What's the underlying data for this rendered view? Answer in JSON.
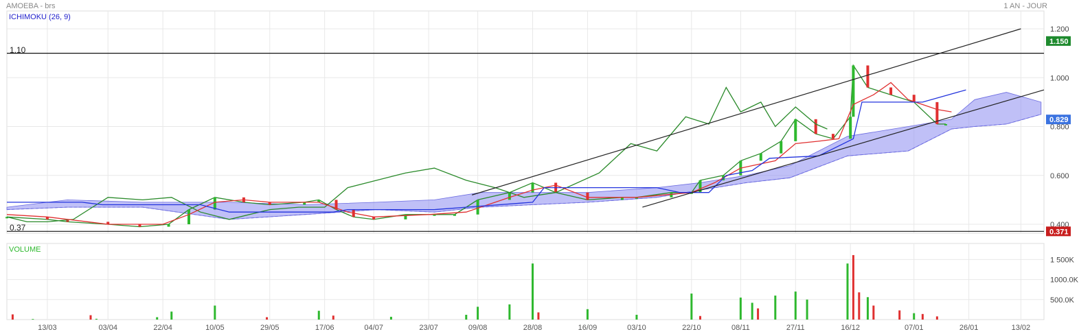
{
  "header": {
    "left": "AMOEBA - brs",
    "right": "1 AN - JOUR"
  },
  "price_panel": {
    "indicator_label": "ICHIMOKU (26, 9)",
    "hline_labels": [
      "1.10",
      "0.37"
    ],
    "y_ticks": [
      "1.200",
      "1.000",
      "0.800",
      "0.600",
      "0.400"
    ],
    "badges": [
      {
        "text": "1.150",
        "color": "#1e8a2e",
        "value": 1.15
      },
      {
        "text": "0.829",
        "color": "#3b73e0",
        "value": 0.829
      },
      {
        "text": "0.371",
        "color": "#c81e1e",
        "value": 0.371
      }
    ]
  },
  "volume_panel": {
    "label": "VOLUME",
    "y_ticks": [
      "1 500K",
      "1000.0K",
      "500.0K"
    ]
  },
  "x_ticks": [
    "13/03",
    "03/04",
    "22/04",
    "10/05",
    "29/05",
    "17/06",
    "04/07",
    "23/07",
    "09/08",
    "28/08",
    "16/09",
    "03/10",
    "22/10",
    "08/11",
    "27/11",
    "16/12",
    "07/01",
    "26/01",
    "13/02"
  ],
  "chart_data": [
    {
      "type": "line",
      "title": "AMOEBA - brs",
      "subtitle": "1 AN - JOUR",
      "indicator": "ICHIMOKU (26, 9)",
      "x_range": [
        "2023-02-27",
        "2024-02-21"
      ],
      "ylim": [
        0.37,
        1.22
      ],
      "horizontal_lines": [
        1.1,
        0.371
      ],
      "trendlines": [
        {
          "from": [
            "2023-08-07",
            0.52
          ],
          "to": [
            "2024-02-13",
            1.2
          ]
        },
        {
          "from": [
            "2023-10-05",
            0.47
          ],
          "to": [
            "2024-02-21",
            0.95
          ]
        }
      ],
      "series": [
        {
          "name": "price",
          "color": "#2a8a2a",
          "points": [
            [
              "2023-02-27",
              0.43
            ],
            [
              "2023-03-13",
              0.42
            ],
            [
              "2023-03-20",
              0.41
            ],
            [
              "2023-04-03",
              0.4
            ],
            [
              "2023-04-14",
              0.39
            ],
            [
              "2023-04-24",
              0.4
            ],
            [
              "2023-05-01",
              0.46
            ],
            [
              "2023-05-10",
              0.51
            ],
            [
              "2023-05-20",
              0.49
            ],
            [
              "2023-05-29",
              0.48
            ],
            [
              "2023-06-10",
              0.49
            ],
            [
              "2023-06-15",
              0.5
            ],
            [
              "2023-06-21",
              0.46
            ],
            [
              "2023-06-27",
              0.43
            ],
            [
              "2023-07-04",
              0.42
            ],
            [
              "2023-07-15",
              0.44
            ],
            [
              "2023-07-25",
              0.44
            ],
            [
              "2023-08-01",
              0.44
            ],
            [
              "2023-08-09",
              0.5
            ],
            [
              "2023-08-20",
              0.53
            ],
            [
              "2023-08-28",
              0.57
            ],
            [
              "2023-09-05",
              0.53
            ],
            [
              "2023-09-16",
              0.5
            ],
            [
              "2023-09-28",
              0.51
            ],
            [
              "2023-10-03",
              0.51
            ],
            [
              "2023-10-15",
              0.53
            ],
            [
              "2023-10-22",
              0.53
            ],
            [
              "2023-10-25",
              0.58
            ],
            [
              "2023-11-02",
              0.6
            ],
            [
              "2023-11-08",
              0.66
            ],
            [
              "2023-11-15",
              0.69
            ],
            [
              "2023-11-22",
              0.74
            ],
            [
              "2023-11-27",
              0.83
            ],
            [
              "2023-12-04",
              0.77
            ],
            [
              "2023-12-10",
              0.75
            ],
            [
              "2023-12-16",
              0.84
            ],
            [
              "2023-12-17",
              1.05
            ],
            [
              "2023-12-22",
              0.96
            ],
            [
              "2023-12-30",
              0.93
            ],
            [
              "2024-01-07",
              0.9
            ],
            [
              "2024-01-15",
              0.81
            ],
            [
              "2024-01-18",
              0.81
            ]
          ]
        },
        {
          "name": "lagging",
          "color": "#2a8a2a",
          "points": [
            [
              "2023-02-27",
              0.43
            ],
            [
              "2023-03-06",
              0.41
            ],
            [
              "2023-03-13",
              0.41
            ],
            [
              "2023-03-22",
              0.42
            ],
            [
              "2023-04-03",
              0.51
            ],
            [
              "2023-04-15",
              0.5
            ],
            [
              "2023-04-25",
              0.51
            ],
            [
              "2023-05-05",
              0.45
            ],
            [
              "2023-05-15",
              0.42
            ],
            [
              "2023-05-29",
              0.46
            ],
            [
              "2023-06-08",
              0.47
            ],
            [
              "2023-06-17",
              0.47
            ],
            [
              "2023-06-25",
              0.55
            ],
            [
              "2023-07-05",
              0.58
            ],
            [
              "2023-07-15",
              0.61
            ],
            [
              "2023-07-25",
              0.63
            ],
            [
              "2023-08-05",
              0.58
            ],
            [
              "2023-08-15",
              0.55
            ],
            [
              "2023-08-25",
              0.51
            ],
            [
              "2023-09-05",
              0.53
            ],
            [
              "2023-09-20",
              0.61
            ],
            [
              "2023-10-01",
              0.73
            ],
            [
              "2023-10-10",
              0.7
            ],
            [
              "2023-10-20",
              0.84
            ],
            [
              "2023-10-28",
              0.81
            ],
            [
              "2023-11-03",
              0.96
            ],
            [
              "2023-11-08",
              0.86
            ],
            [
              "2023-11-15",
              0.9
            ],
            [
              "2023-11-20",
              0.8
            ],
            [
              "2023-11-27",
              0.88
            ],
            [
              "2023-12-04",
              0.81
            ],
            [
              "2023-12-08",
              0.79
            ]
          ]
        },
        {
          "name": "tenkan",
          "color": "#e03030",
          "points": [
            [
              "2023-02-27",
              0.44
            ],
            [
              "2023-03-13",
              0.43
            ],
            [
              "2023-04-03",
              0.4
            ],
            [
              "2023-04-22",
              0.4
            ],
            [
              "2023-05-01",
              0.44
            ],
            [
              "2023-05-10",
              0.49
            ],
            [
              "2023-05-20",
              0.5
            ],
            [
              "2023-05-29",
              0.49
            ],
            [
              "2023-06-15",
              0.49
            ],
            [
              "2023-06-25",
              0.45
            ],
            [
              "2023-07-04",
              0.43
            ],
            [
              "2023-07-23",
              0.44
            ],
            [
              "2023-08-05",
              0.45
            ],
            [
              "2023-08-20",
              0.51
            ],
            [
              "2023-08-28",
              0.54
            ],
            [
              "2023-09-05",
              0.56
            ],
            [
              "2023-09-16",
              0.51
            ],
            [
              "2023-10-03",
              0.51
            ],
            [
              "2023-10-22",
              0.53
            ],
            [
              "2023-10-30",
              0.57
            ],
            [
              "2023-11-08",
              0.63
            ],
            [
              "2023-11-20",
              0.66
            ],
            [
              "2023-11-27",
              0.73
            ],
            [
              "2023-12-05",
              0.74
            ],
            [
              "2023-12-12",
              0.75
            ],
            [
              "2023-12-17",
              0.89
            ],
            [
              "2023-12-24",
              0.93
            ],
            [
              "2023-12-30",
              0.98
            ],
            [
              "2024-01-05",
              0.91
            ],
            [
              "2024-01-15",
              0.87
            ],
            [
              "2024-01-20",
              0.86
            ]
          ]
        },
        {
          "name": "kijun",
          "color": "#2233dd",
          "points": [
            [
              "2023-02-27",
              0.49
            ],
            [
              "2023-03-25",
              0.49
            ],
            [
              "2023-04-01",
              0.48
            ],
            [
              "2023-05-05",
              0.48
            ],
            [
              "2023-05-15",
              0.45
            ],
            [
              "2023-06-20",
              0.45
            ],
            [
              "2023-06-25",
              0.46
            ],
            [
              "2023-07-25",
              0.46
            ],
            [
              "2023-08-05",
              0.47
            ],
            [
              "2023-08-28",
              0.49
            ],
            [
              "2023-09-01",
              0.55
            ],
            [
              "2023-10-10",
              0.55
            ],
            [
              "2023-10-18",
              0.53
            ],
            [
              "2023-10-28",
              0.53
            ],
            [
              "2023-11-03",
              0.6
            ],
            [
              "2023-11-12",
              0.62
            ],
            [
              "2023-11-18",
              0.67
            ],
            [
              "2023-12-05",
              0.68
            ],
            [
              "2023-12-17",
              0.75
            ],
            [
              "2023-12-20",
              0.9
            ],
            [
              "2024-01-10",
              0.9
            ],
            [
              "2024-01-25",
              0.95
            ]
          ]
        }
      ],
      "cloud": {
        "color": "#8c8cf0",
        "points": [
          [
            "2023-02-27",
            0.47,
            0.46
          ],
          [
            "2023-03-20",
            0.5,
            0.47
          ],
          [
            "2023-04-15",
            0.49,
            0.47
          ],
          [
            "2023-05-15",
            0.49,
            0.42
          ],
          [
            "2023-06-10",
            0.48,
            0.44
          ],
          [
            "2023-07-05",
            0.49,
            0.46
          ],
          [
            "2023-07-25",
            0.5,
            0.45
          ],
          [
            "2023-08-10",
            0.53,
            0.47
          ],
          [
            "2023-08-28",
            0.53,
            0.48
          ],
          [
            "2023-09-16",
            0.53,
            0.49
          ],
          [
            "2023-10-10",
            0.55,
            0.51
          ],
          [
            "2023-10-25",
            0.57,
            0.54
          ],
          [
            "2023-11-10",
            0.6,
            0.57
          ],
          [
            "2023-11-25",
            0.64,
            0.59
          ],
          [
            "2023-12-15",
            0.76,
            0.68
          ],
          [
            "2024-01-05",
            0.8,
            0.7
          ],
          [
            "2024-01-20",
            0.83,
            0.79
          ],
          [
            "2024-01-28",
            0.91,
            0.8
          ],
          [
            "2024-02-08",
            0.94,
            0.81
          ],
          [
            "2024-02-20",
            0.9,
            0.85
          ]
        ]
      }
    },
    {
      "type": "bar",
      "title": "VOLUME",
      "ylim": [
        0,
        1900000
      ],
      "series": [
        {
          "name": "up",
          "color": "#2eb82e",
          "values": [
            [
              "2023-03-08",
              15000
            ],
            [
              "2023-03-30",
              20000
            ],
            [
              "2023-04-20",
              60000
            ],
            [
              "2023-04-25",
              200000
            ],
            [
              "2023-05-10",
              350000
            ],
            [
              "2023-06-15",
              220000
            ],
            [
              "2023-07-10",
              70000
            ],
            [
              "2023-08-05",
              120000
            ],
            [
              "2023-08-09",
              320000
            ],
            [
              "2023-08-20",
              380000
            ],
            [
              "2023-08-28",
              1400000
            ],
            [
              "2023-09-16",
              260000
            ],
            [
              "2023-10-03",
              120000
            ],
            [
              "2023-10-22",
              650000
            ],
            [
              "2023-11-08",
              550000
            ],
            [
              "2023-11-12",
              420000
            ],
            [
              "2023-11-20",
              600000
            ],
            [
              "2023-11-27",
              700000
            ],
            [
              "2023-12-01",
              500000
            ],
            [
              "2023-12-15",
              1400000
            ],
            [
              "2023-12-22",
              560000
            ],
            [
              "2024-01-07",
              160000
            ]
          ]
        },
        {
          "name": "down",
          "color": "#e03030",
          "values": [
            [
              "2023-03-01",
              130000
            ],
            [
              "2023-03-28",
              110000
            ],
            [
              "2023-05-28",
              60000
            ],
            [
              "2023-06-20",
              100000
            ],
            [
              "2023-08-30",
              180000
            ],
            [
              "2023-10-25",
              90000
            ],
            [
              "2023-11-14",
              280000
            ],
            [
              "2023-12-17",
              1610000
            ],
            [
              "2023-12-19",
              680000
            ],
            [
              "2023-12-24",
              350000
            ],
            [
              "2024-01-02",
              230000
            ],
            [
              "2024-01-10",
              140000
            ],
            [
              "2024-01-15",
              80000
            ]
          ]
        }
      ]
    }
  ]
}
